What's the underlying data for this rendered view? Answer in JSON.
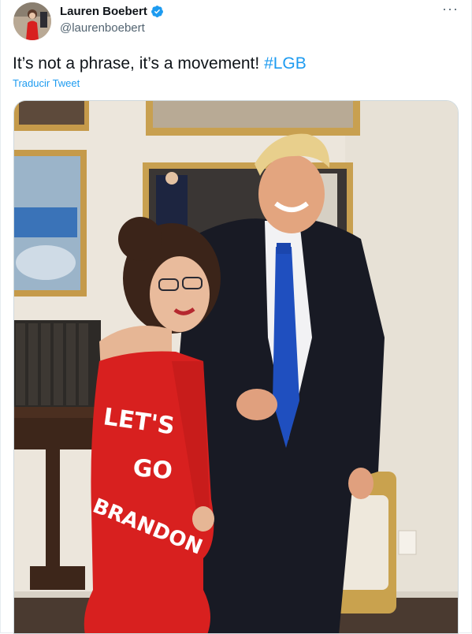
{
  "author": {
    "name": "Lauren Boebert",
    "handle": "@laurenboebert"
  },
  "tweet": {
    "text": "It’s not a phrase, it’s a movement! ",
    "hashtag": "#LGB",
    "translate_link": "Traducir Tweet"
  },
  "menu": {
    "more": "···"
  },
  "photo": {
    "dress_text": [
      "LET'S",
      "GO",
      "BRANDON"
    ]
  },
  "colors": {
    "link": "#1d9bf0",
    "verified": "#1d9bf0",
    "text": "#0f1419",
    "secondary": "#536471",
    "dress": "#d8201f",
    "tie": "#1f4fbf"
  },
  "icons": [
    "verified-badge-icon",
    "more-options-icon"
  ]
}
